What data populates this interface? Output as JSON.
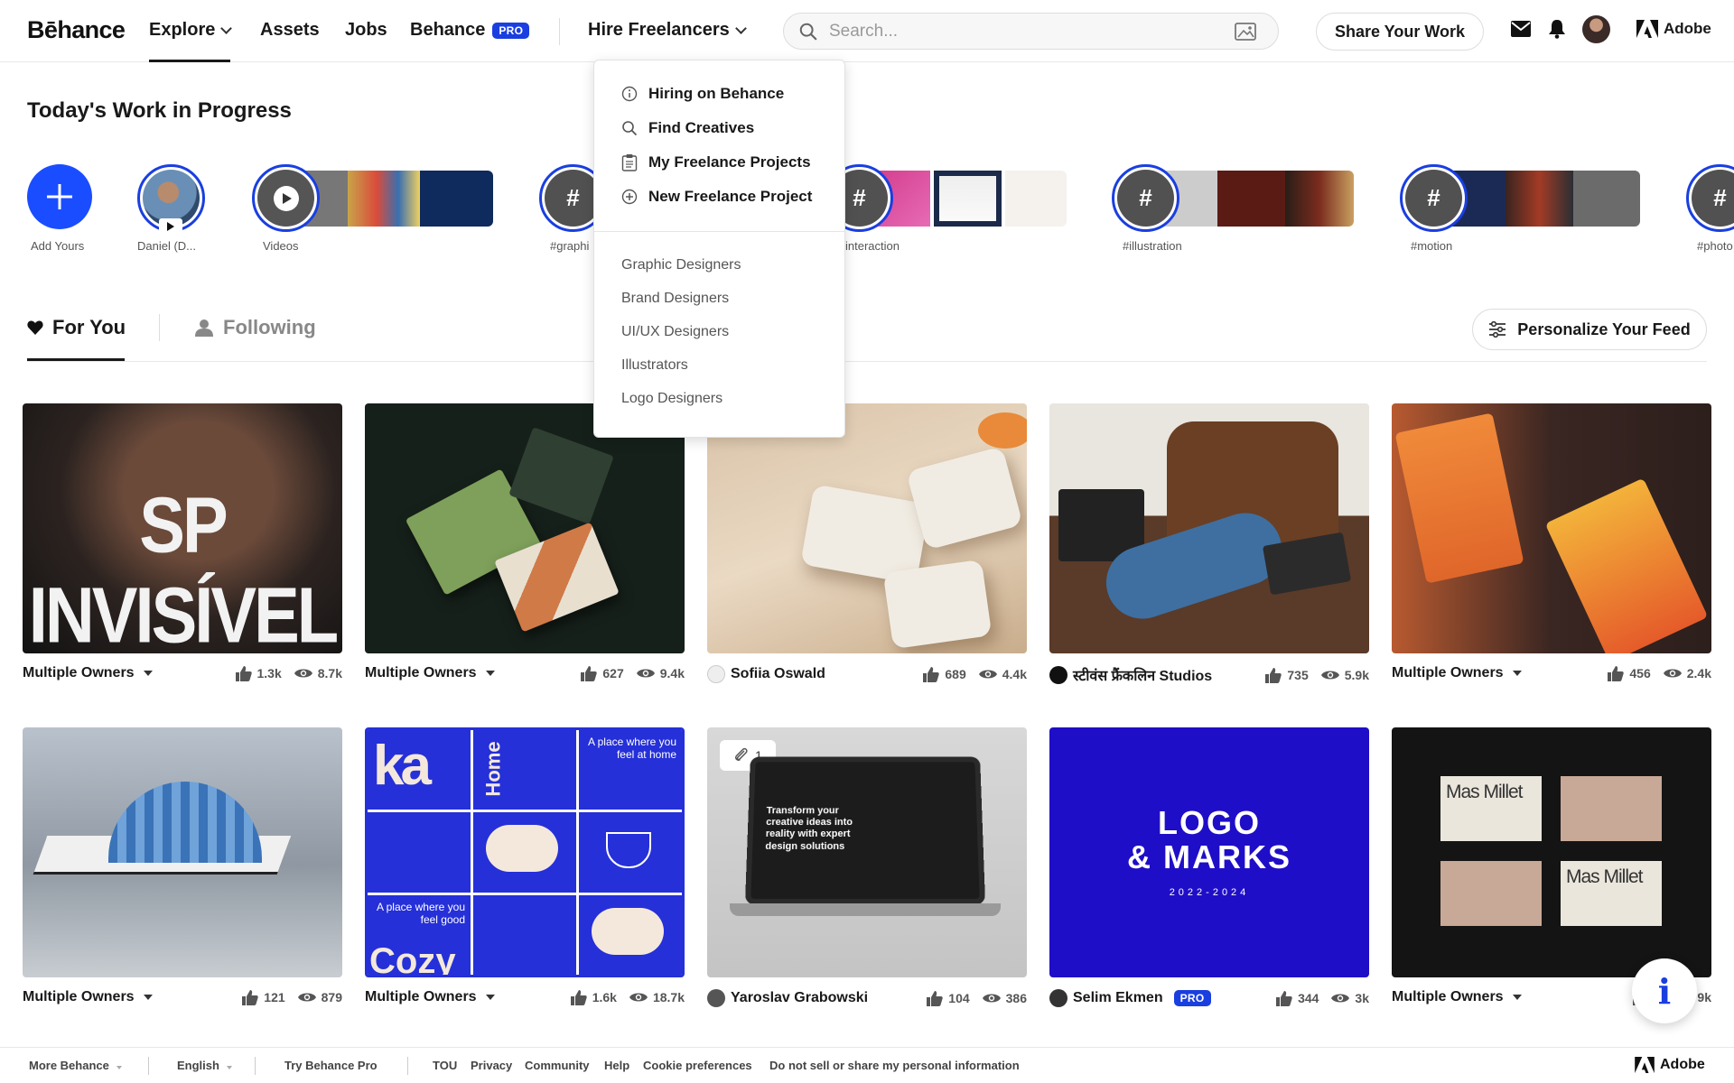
{
  "header": {
    "logo": "Bēhance",
    "nav": {
      "explore": "Explore",
      "assets": "Assets",
      "jobs": "Jobs",
      "behance": "Behance",
      "pro": "PRO",
      "hire": "Hire Freelancers"
    },
    "search_placeholder": "Search...",
    "share_label": "Share Your Work",
    "adobe_label": "Adobe"
  },
  "hire_menu": {
    "items": [
      "Hiring on Behance",
      "Find Creatives",
      "My Freelance Projects",
      "New Freelance Project"
    ],
    "categories": [
      "Graphic Designers",
      "Brand Designers",
      "UI/UX Designers",
      "Illustrators",
      "Logo Designers"
    ]
  },
  "wip": {
    "title": "Today's Work in Progress",
    "stories": [
      "Add Yours",
      "Daniel (D...",
      "Videos",
      "#graphi",
      "interaction",
      "#illustration",
      "#motion",
      "#photo"
    ]
  },
  "feed_tabs": {
    "for_you": "For You",
    "following": "Following",
    "personalize": "Personalize Your Feed"
  },
  "cards": [
    {
      "owner": "Multiple Owners",
      "multi": true,
      "likes": "1.3k",
      "views": "8.7k",
      "title_art": "SP INVISÍVEL"
    },
    {
      "owner": "Multiple Owners",
      "multi": true,
      "likes": "627",
      "views": "9.4k"
    },
    {
      "owner": "Sofiia Oswald",
      "multi": false,
      "likes": "689",
      "views": "4.4k"
    },
    {
      "owner": "स्टीवंस फ्रैंकलिन Studios",
      "multi": false,
      "likes": "735",
      "views": "5.9k"
    },
    {
      "owner": "Multiple Owners",
      "multi": true,
      "likes": "456",
      "views": "2.4k"
    },
    {
      "owner": "Multiple Owners",
      "multi": true,
      "likes": "121",
      "views": "879"
    },
    {
      "owner": "Multiple Owners",
      "multi": true,
      "likes": "1.6k",
      "views": "18.7k"
    },
    {
      "owner": "Yaroslav Grabowski",
      "multi": false,
      "likes": "104",
      "views": "386",
      "attachments": "1",
      "laptop_text": "Transform your creative ideas into reality with expert design solutions"
    },
    {
      "owner": "Selim Ekmen",
      "multi": false,
      "pro": "PRO",
      "likes": "344",
      "views": "3k",
      "art_line1": "LOGO",
      "art_line2": "& MARKS",
      "art_years": "2022-2024"
    },
    {
      "owner": "Multiple Owners",
      "multi": true,
      "likes": "4",
      "views": "9k",
      "card_text": "Mas Millet"
    }
  ],
  "card_art_text": {
    "ka": "ka",
    "home": "Home",
    "place1": "A place where you feel at home",
    "place2": "A place where you feel good",
    "cozy": "Cozy"
  },
  "footer": {
    "more": "More Behance",
    "lang": "English",
    "try_pro": "Try Behance Pro",
    "links": [
      "TOU",
      "Privacy",
      "Community",
      "Help",
      "Cookie preferences",
      "Do not sell or share my personal information"
    ],
    "adobe": "Adobe"
  },
  "info_fab": "i",
  "colors": {
    "brand_blue": "#1a3fe0",
    "text": "#191919"
  }
}
